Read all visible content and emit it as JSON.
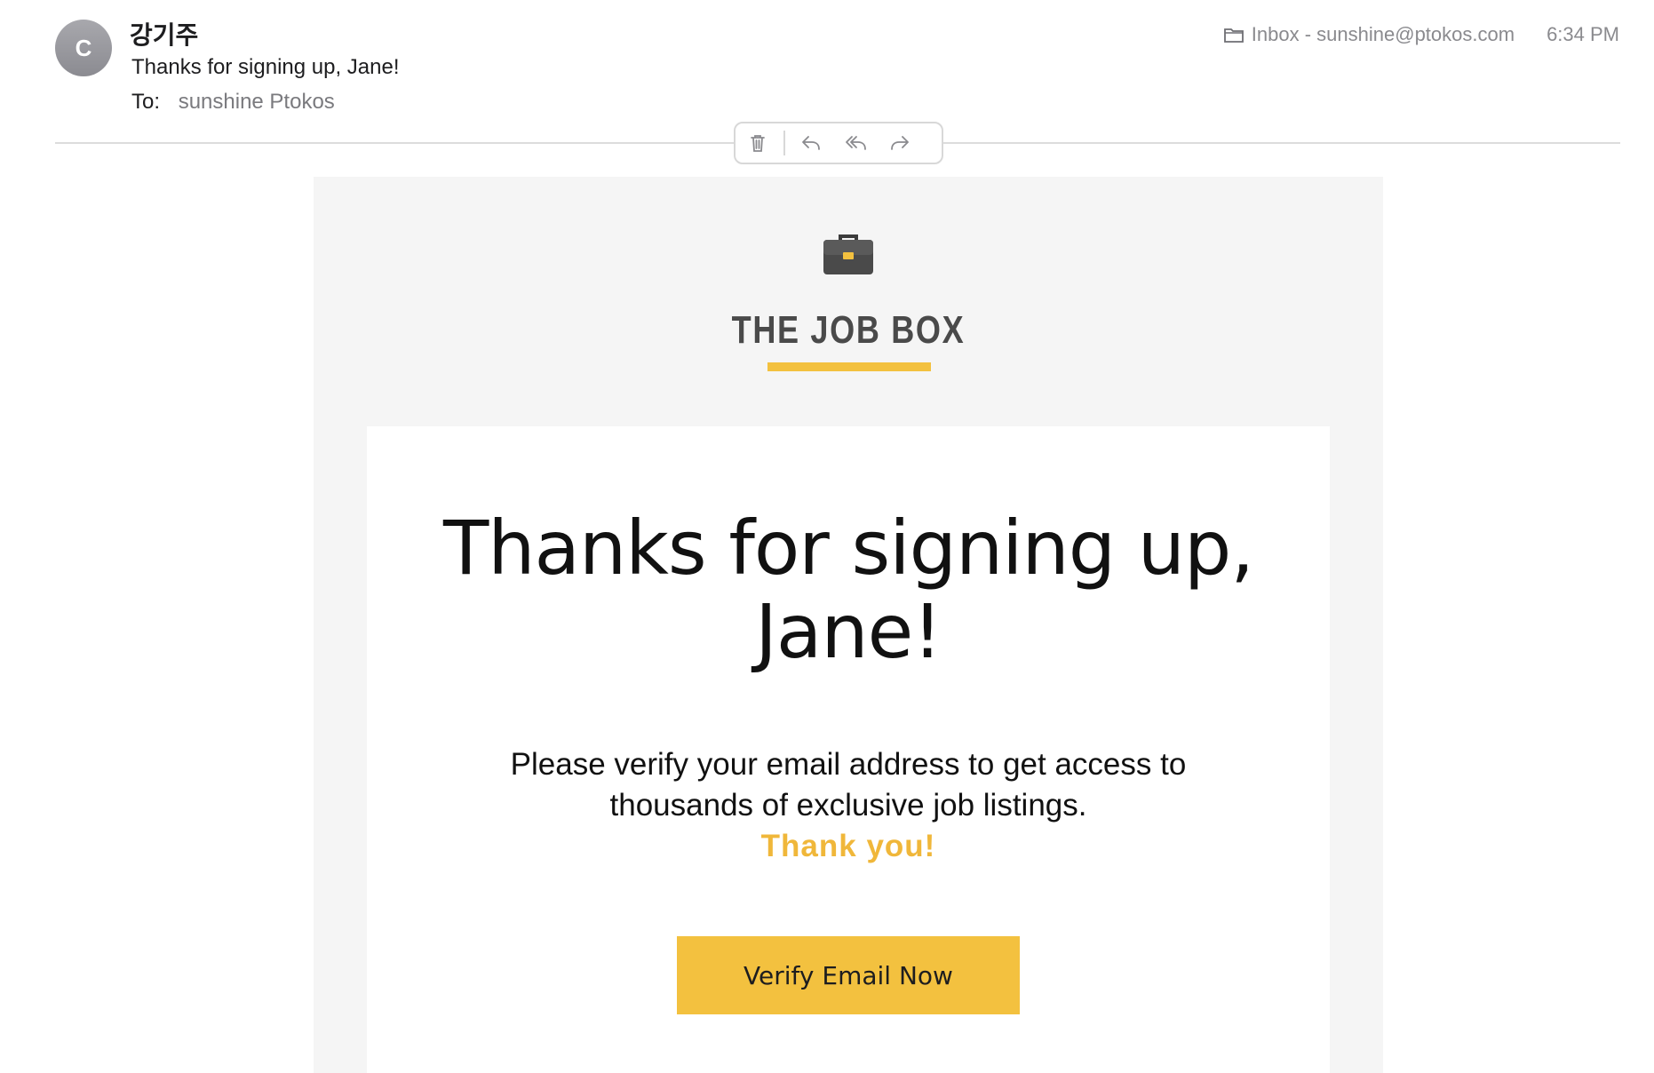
{
  "header": {
    "avatar_initial": "C",
    "sender_name": "강기주",
    "subject": "Thanks for signing up, Jane!",
    "to_label": "To:",
    "to_value": "sunshine Ptokos",
    "mailbox": "Inbox - sunshine@ptokos.com",
    "time": "6:34 PM"
  },
  "toolbar": {
    "icons": [
      "trash-icon",
      "reply-icon",
      "reply-all-icon",
      "forward-icon"
    ]
  },
  "email": {
    "brand_icon": "briefcase-icon",
    "brand_name": "THE JOB BOX",
    "headline": "Thanks for signing up, Jane!",
    "body_line": "Please verify your email address to get access to thousands of exclusive job listings.",
    "thanks": "Thank you!",
    "cta_label": "Verify Email Now"
  },
  "colors": {
    "accent": "#f3c13f",
    "email_background": "#f5f5f5",
    "avatar": "#9a9aa0"
  }
}
